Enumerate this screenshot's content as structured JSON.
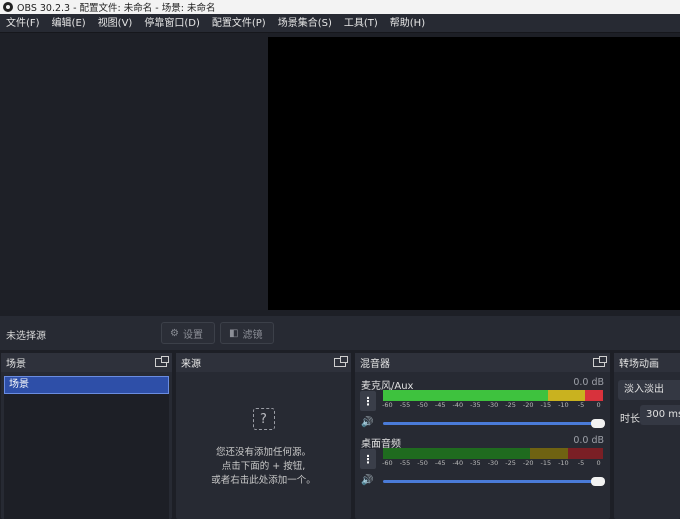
{
  "window": {
    "title": "OBS 30.2.3 - 配置文件: 未命名 - 场景: 未命名"
  },
  "menu": [
    "文件(F)",
    "编辑(E)",
    "视图(V)",
    "停靠窗口(D)",
    "配置文件(P)",
    "场景集合(S)",
    "工具(T)",
    "帮助(H)"
  ],
  "source_bar": {
    "no_source": "未选择源",
    "settings_label": "设置",
    "filters_label": "滤镜"
  },
  "docks": {
    "scenes": {
      "title": "场景",
      "items": [
        "场景"
      ]
    },
    "sources": {
      "title": "来源",
      "empty_icon": "?",
      "empty_text_1": "您还没有添加任何源。",
      "empty_text_2": "点击下面的 + 按钮,",
      "empty_text_3": "或者右击此处添加一个。"
    },
    "mixer": {
      "title": "混音器",
      "scale": [
        "-60",
        "-55",
        "-50",
        "-45",
        "-40",
        "-35",
        "-30",
        "-25",
        "-20",
        "-15",
        "-10",
        "-5",
        "0"
      ],
      "channels": [
        {
          "name": "麦克风/Aux",
          "db": "0.0 dB",
          "level": 1.0
        },
        {
          "name": "桌面音频",
          "db": "0.0 dB",
          "level": 1.0
        }
      ]
    },
    "transitions": {
      "title": "转场动画",
      "selected": "淡入淡出",
      "duration_label": "时长",
      "duration": "300 ms"
    }
  },
  "colors": {
    "meter_green": "#3ec23e",
    "meter_green_dim": "#1f6b1f",
    "meter_yellow": "#c9b21f",
    "meter_yellow_dim": "#6f6212",
    "meter_red": "#d8323c",
    "meter_red_dim": "#7a1f25",
    "accent": "#4a7bd8"
  }
}
